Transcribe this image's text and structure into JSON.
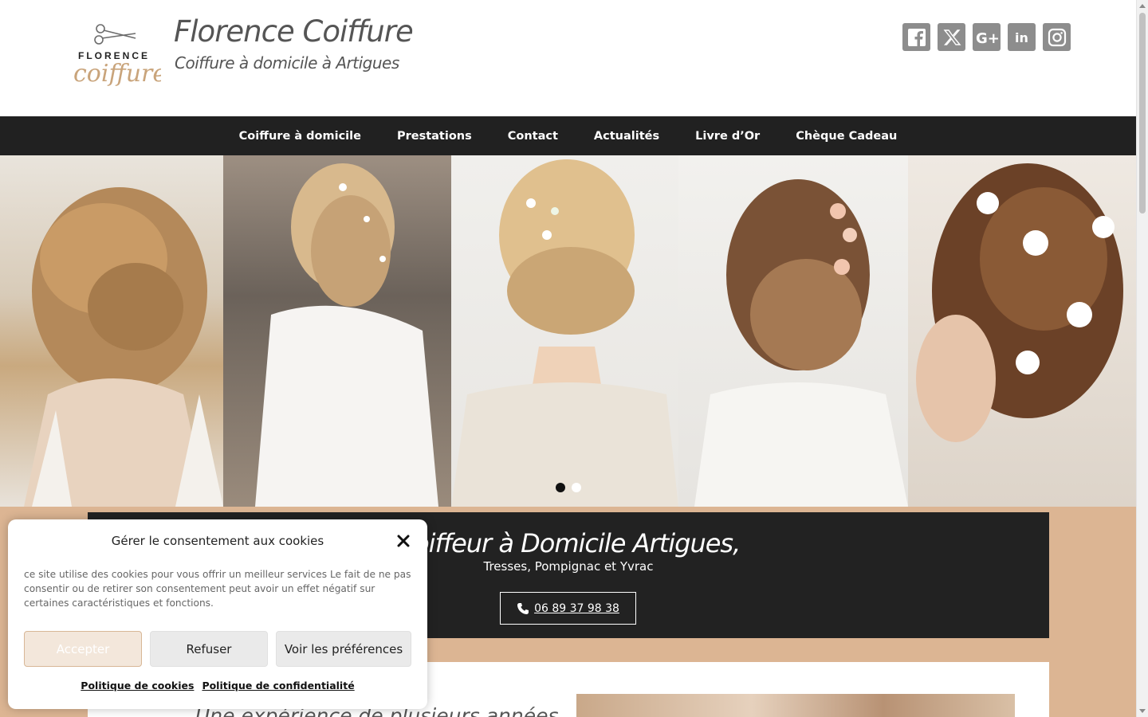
{
  "header": {
    "title": "Florence Coiffure",
    "tagline": "Coiffure à domicile à Artigues",
    "logo_text_top": "FLORENCE",
    "logo_text_bottom": "coiffure"
  },
  "socials": [
    {
      "name": "facebook-icon"
    },
    {
      "name": "x-icon"
    },
    {
      "name": "google-plus-icon"
    },
    {
      "name": "linkedin-icon"
    },
    {
      "name": "instagram-icon"
    }
  ],
  "nav": {
    "items": [
      {
        "label": "Coiffure à domicile"
      },
      {
        "label": "Prestations"
      },
      {
        "label": "Contact"
      },
      {
        "label": "Actualités"
      },
      {
        "label": "Livre d’Or"
      },
      {
        "label": "Chèque Cadeau"
      }
    ]
  },
  "slider": {
    "active_index": 0,
    "dot_count": 2
  },
  "hero": {
    "heading": "Coiffeur à Domicile Artigues,",
    "subheading": "Tresses, Pompignac et Yvrac",
    "phone": "06 89 37 98 38"
  },
  "section": {
    "heading": "Une expérience de plusieurs années"
  },
  "cookie": {
    "title": "Gérer le consentement aux cookies",
    "text": "ce site utilise des cookies pour vous offrir un meilleur services Le fait de ne pas consentir ou de retirer son consentement peut avoir un effet négatif sur certaines caractéristiques et fonctions.",
    "accept_label": "Accepter",
    "refuse_label": "Refuser",
    "prefs_label": "Voir les préférences",
    "cookie_policy_label": "Politique de cookies",
    "privacy_policy_label": "Politique de confidentialité"
  },
  "colors": {
    "nav_bg": "#212121",
    "tan": "#dcb593",
    "dark_box": "#222222",
    "social_bg": "#8d8d8d"
  }
}
